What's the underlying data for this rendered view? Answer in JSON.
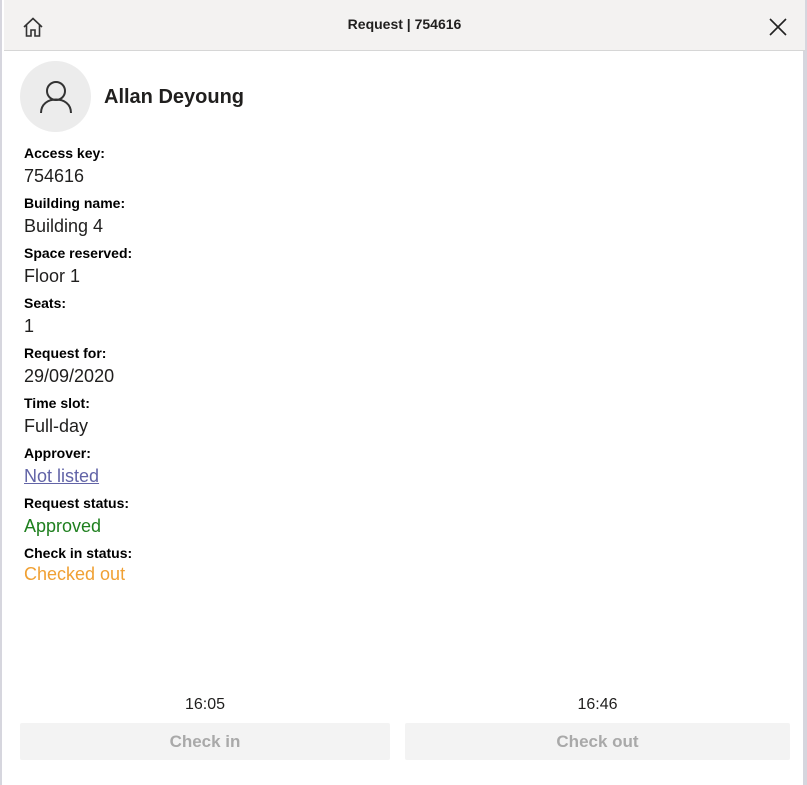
{
  "header": {
    "title": "Request | 754616",
    "home_icon": "home-icon",
    "close_icon": "close-icon"
  },
  "user": {
    "name": "Allan Deyoung",
    "avatar_icon": "person-icon"
  },
  "fields": [
    {
      "label": "Access key:",
      "value": "754616"
    },
    {
      "label": "Building name:",
      "value": "Building 4"
    },
    {
      "label": "Space reserved:",
      "value": "Floor 1"
    },
    {
      "label": "Seats:",
      "value": "1"
    },
    {
      "label": "Request for:",
      "value": "29/09/2020"
    },
    {
      "label": "Time slot:",
      "value": "Full-day"
    },
    {
      "label": "Approver:",
      "value": "Not listed"
    },
    {
      "label": "Request status:",
      "value": "Approved"
    },
    {
      "label": "Check in status:",
      "value": "Checked out"
    }
  ],
  "colors": {
    "link": "#6264a7",
    "approved": "#1e7f1e",
    "checked_out": "#f0a033",
    "disabled_button_bg": "#f3f3f3",
    "disabled_button_text": "#a9a9a9"
  },
  "actions": {
    "check_in_time": "16:05",
    "check_in_label": "Check in",
    "check_out_time": "16:46",
    "check_out_label": "Check out"
  }
}
